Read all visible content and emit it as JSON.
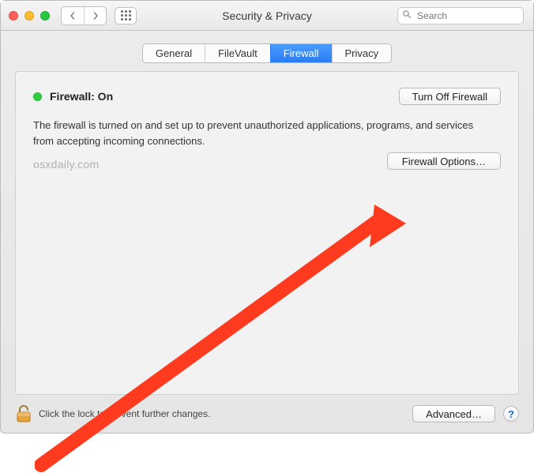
{
  "window": {
    "title": "Security & Privacy"
  },
  "search": {
    "placeholder": "Search"
  },
  "tabs": {
    "general": "General",
    "filevault": "FileVault",
    "firewall": "Firewall",
    "privacy": "Privacy"
  },
  "firewall": {
    "status_label": "Firewall: On",
    "toggle_button": "Turn Off Firewall",
    "description": "The firewall is turned on and set up to prevent unauthorized applications, programs, and services from accepting incoming connections.",
    "options_button": "Firewall Options…",
    "watermark": "osxdaily.com"
  },
  "footer": {
    "lock_text": "Click the lock to prevent further changes.",
    "advanced_button": "Advanced…",
    "help_label": "?"
  }
}
